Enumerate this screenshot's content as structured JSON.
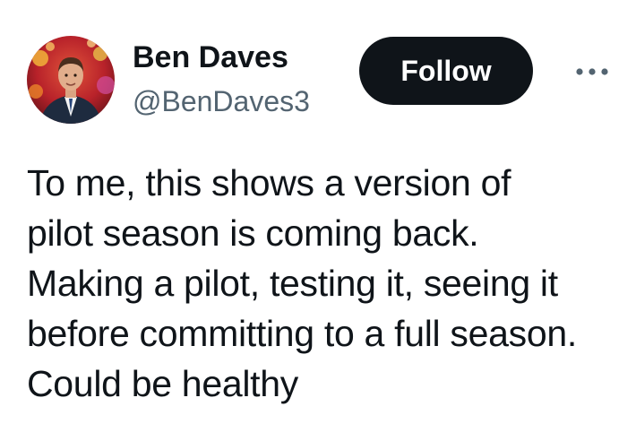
{
  "author": {
    "display_name": "Ben Daves",
    "handle": "@BenDaves3"
  },
  "actions": {
    "follow_label": "Follow",
    "more_icon": "more-horizontal-icon"
  },
  "tweet": {
    "text_lines": [
      "To me, this shows a version of",
      "pilot season is coming back.",
      "Making a pilot, testing it, seeing it",
      "before committing to a full season.",
      "Could be healthy"
    ]
  },
  "colors": {
    "text_primary": "#0f1419",
    "text_secondary": "#536471",
    "button_bg": "#0f1419",
    "button_text": "#ffffff",
    "background": "#ffffff"
  }
}
